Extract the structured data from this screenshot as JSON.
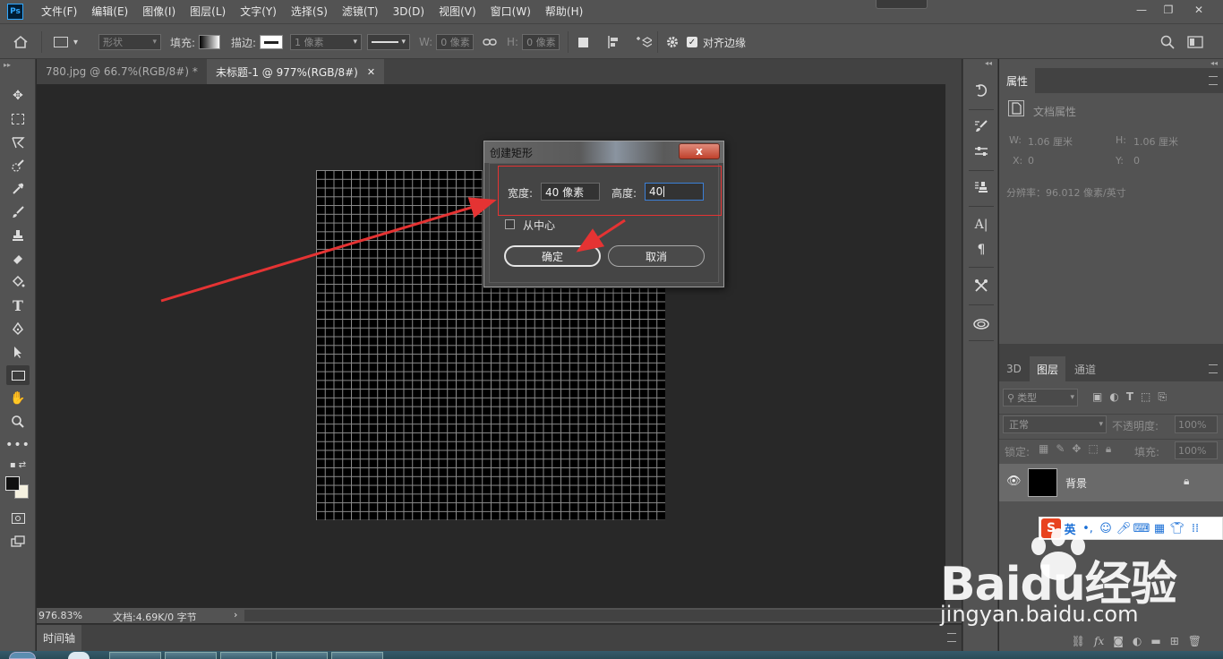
{
  "app": {
    "logo": "Ps"
  },
  "menu": [
    "文件(F)",
    "编辑(E)",
    "图像(I)",
    "图层(L)",
    "文字(Y)",
    "选择(S)",
    "滤镜(T)",
    "3D(D)",
    "视图(V)",
    "窗口(W)",
    "帮助(H)"
  ],
  "window_controls": {
    "minimize": "—",
    "restore": "❐",
    "close": "✕"
  },
  "options": {
    "mode": "形状",
    "fill_label": "填充:",
    "stroke_label": "描边:",
    "stroke_width": "1 像素",
    "w_label": "W:",
    "w_value": "0 像素",
    "h_label": "H:",
    "h_value": "0 像素",
    "align_edges_label": "对齐边缘",
    "align_edges_checked": true
  },
  "tabs": [
    {
      "label": "780.jpg @ 66.7%(RGB/8#) *",
      "close": "✕"
    },
    {
      "label": "未标题-1 @ 977%(RGB/8#)",
      "close": "✕"
    }
  ],
  "status": {
    "zoom": "976.83%",
    "doc": "文档:4.69K/0 字节",
    "arrow": "›"
  },
  "timeline": {
    "label": "时间轴"
  },
  "properties": {
    "tab": "属性",
    "doc_props": "文档属性",
    "w_label": "W:",
    "w_value": "1.06 厘米",
    "h_label": "H:",
    "h_value": "1.06 厘米",
    "x_label": "X:",
    "x_value": "0",
    "y_label": "Y:",
    "y_value": "0",
    "resolution": "分辨率：96.012 像素/英寸"
  },
  "layers": {
    "tabs": [
      "3D",
      "图层",
      "通道"
    ],
    "filter": "类型",
    "blend_mode": "正常",
    "opacity_label": "不透明度:",
    "opacity_value": "100%",
    "lock_label": "锁定:",
    "fill_label": "填充:",
    "fill_value": "100%",
    "layer_name": "背景"
  },
  "dialog": {
    "title": "创建矩形",
    "close": "x",
    "width_label": "宽度:",
    "width_value": "40 像素",
    "height_label": "高度:",
    "height_value": "40",
    "from_center_label": "从中心",
    "from_center_checked": false,
    "ok": "确定",
    "cancel": "取消"
  },
  "ime": {
    "lang": "英"
  },
  "watermark": {
    "main": "Baidu经验",
    "sub": "jingyan.baidu.com"
  },
  "colors": {
    "accent_red": "#e53333",
    "panel": "#535353",
    "canvas_bg": "#282828",
    "focus_blue": "#3b7fd6"
  }
}
